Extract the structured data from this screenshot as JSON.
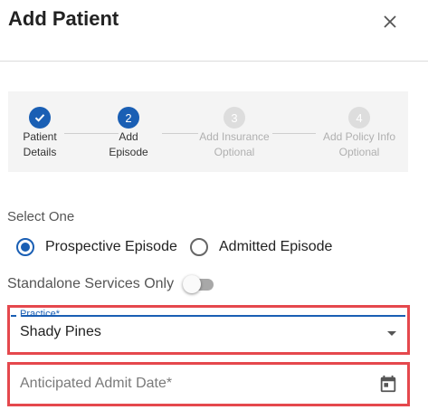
{
  "dialog": {
    "title": "Add Patient"
  },
  "stepper": {
    "steps": [
      {
        "number": "",
        "line1": "Patient",
        "line2": "Details",
        "state": "completed"
      },
      {
        "number": "2",
        "line1": "Add",
        "line2": "Episode",
        "state": "active"
      },
      {
        "number": "3",
        "line1": "Add Insurance",
        "line2": "Optional",
        "state": "inactive"
      },
      {
        "number": "4",
        "line1": "Add Policy Info",
        "line2": "Optional",
        "state": "inactive"
      }
    ]
  },
  "episode": {
    "prompt": "Select One",
    "options": [
      {
        "label": "Prospective Episode",
        "checked": true
      },
      {
        "label": "Admitted Episode",
        "checked": false
      }
    ]
  },
  "standalone": {
    "label": "Standalone Services Only",
    "on": false
  },
  "practice": {
    "label": "Practice*",
    "value": "Shady Pines"
  },
  "admit_date": {
    "placeholder": "Anticipated Admit Date*"
  },
  "icons": {
    "close": "close-icon",
    "check": "check-icon",
    "dropdown": "chevron-down-icon",
    "calendar": "calendar-icon"
  },
  "colors": {
    "accent": "#1a5fb4",
    "highlight": "#e5484d"
  }
}
